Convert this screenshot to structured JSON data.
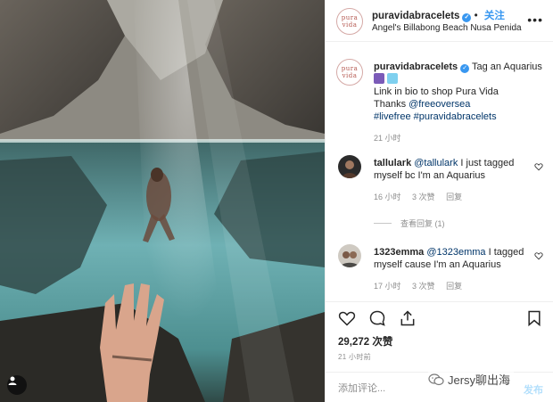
{
  "post": {
    "username": "puravidabracelets",
    "follow_label": "关注",
    "location": "Angel's Billabong Beach Nusa Penida",
    "more_label": "•••",
    "avatar_text": "pura vida"
  },
  "caption": {
    "username": "puravidabracelets",
    "line1": "Tag an Aquarius",
    "line2": "Link in bio to shop Pura Vida",
    "line3_prefix": "Thanks ",
    "mention": "@freeoversea",
    "hashtags": "#livefree #puravidabracelets",
    "time": "21 小时"
  },
  "comments": [
    {
      "username": "tallulark",
      "mention": "@tallulark",
      "text": " I just tagged myself bc I'm an Aquarius",
      "time": "16 小时",
      "likes": "3 次赞",
      "reply": "回复",
      "view_replies": "查看回复 (1)"
    },
    {
      "username": "1323emma",
      "mention": "@1323emma",
      "text": " I tagged myself cause I'm an Aquarius",
      "time": "17 小时",
      "likes": "3 次赞",
      "reply": "回复"
    }
  ],
  "stats": {
    "likes": "29,272 次赞",
    "date": "21 小时前"
  },
  "composer": {
    "placeholder": "添加评论...",
    "post_label": "发布"
  },
  "watermark": {
    "text": "Jersy聊出海"
  },
  "icons": [
    "verified-badge-icon",
    "more-icon",
    "heart-icon",
    "comment-icon",
    "share-icon",
    "bookmark-icon",
    "user-tag-icon",
    "wechat-icon"
  ],
  "colors": {
    "accent": "#3897f0",
    "text": "#262626",
    "muted": "#8e8e8e",
    "link": "#003569",
    "brand": "#b4574f"
  }
}
